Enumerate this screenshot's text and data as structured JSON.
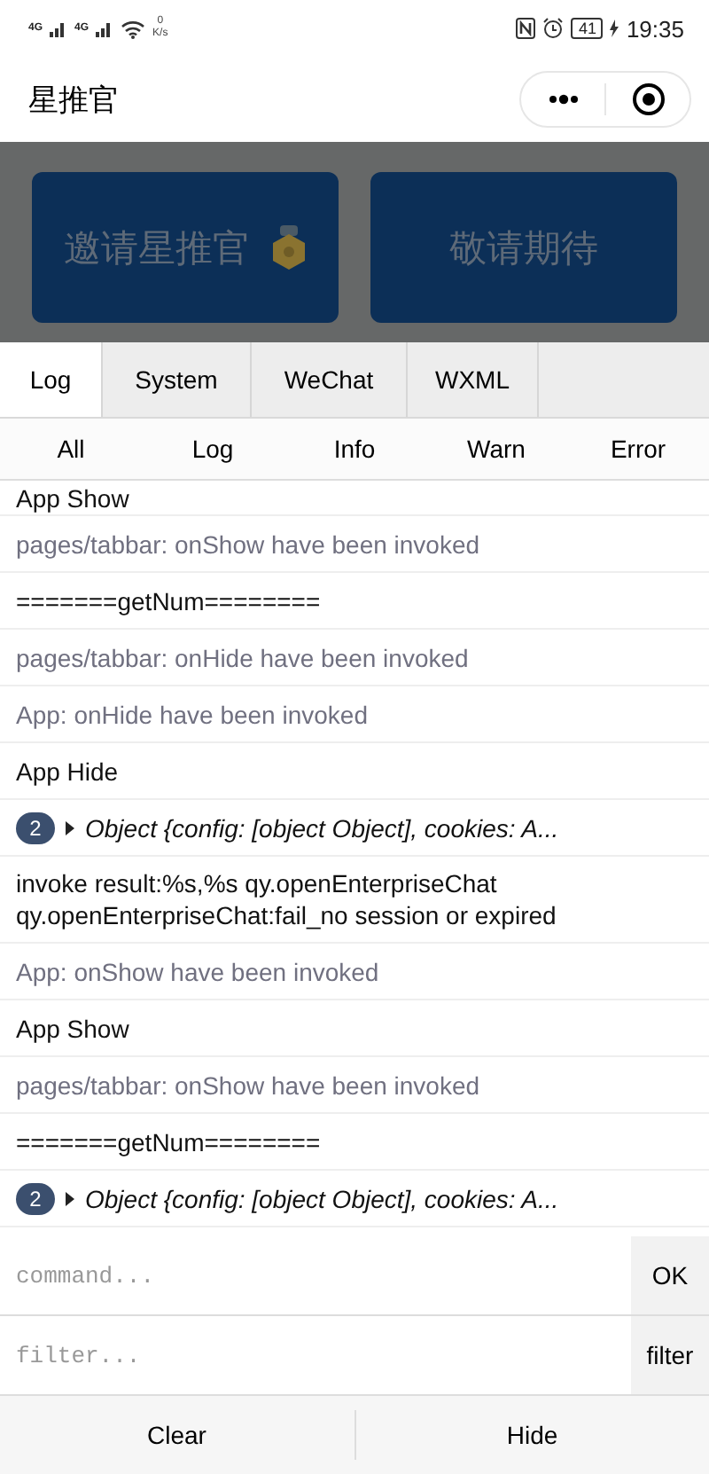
{
  "status_bar": {
    "network_badges": [
      "4G",
      "4G"
    ],
    "speed_value": "0",
    "speed_unit": "K/s",
    "battery": "41",
    "time": "19:35"
  },
  "nav_bar": {
    "title": "星推官"
  },
  "page_cards": [
    {
      "label": "邀请星推官",
      "has_medal": true
    },
    {
      "label": "敬请期待",
      "has_medal": false
    }
  ],
  "console_tabs": [
    {
      "label": "Log",
      "selected": true
    },
    {
      "label": "System",
      "selected": false
    },
    {
      "label": "WeChat",
      "selected": false
    },
    {
      "label": "WXML",
      "selected": false
    }
  ],
  "level_filters": [
    "All",
    "Log",
    "Info",
    "Warn",
    "Error"
  ],
  "log_entries": [
    {
      "kind": "log",
      "text": "App Show"
    },
    {
      "kind": "info",
      "text": "pages/tabbar: onShow have been invoked"
    },
    {
      "kind": "log",
      "text": "=======getNum========"
    },
    {
      "kind": "info",
      "text": "pages/tabbar: onHide have been invoked"
    },
    {
      "kind": "info",
      "text": "App: onHide have been invoked"
    },
    {
      "kind": "log",
      "text": "App Hide"
    },
    {
      "kind": "object",
      "count": "2",
      "text": "Object {config: [object Object], cookies: A..."
    },
    {
      "kind": "log",
      "text": "invoke result:%s,%s qy.openEnterpriseChat qy.openEnterpriseChat:fail_no session or expired"
    },
    {
      "kind": "info",
      "text": "App: onShow have been invoked"
    },
    {
      "kind": "log",
      "text": "App Show"
    },
    {
      "kind": "info",
      "text": "pages/tabbar: onShow have been invoked"
    },
    {
      "kind": "log",
      "text": "=======getNum========"
    },
    {
      "kind": "object",
      "count": "2",
      "text": "Object {config: [object Object], cookies: A..."
    }
  ],
  "command": {
    "placeholder": "command...",
    "button": "OK"
  },
  "filter": {
    "placeholder": "filter...",
    "button": "filter"
  },
  "footer_buttons": [
    "Clear",
    "Hide"
  ]
}
